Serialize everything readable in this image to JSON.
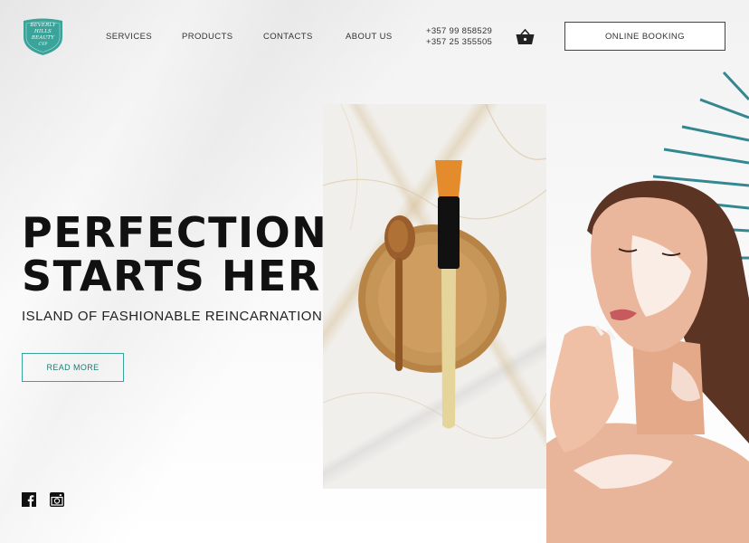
{
  "brand": {
    "logo_line1": "BEVERLY HILLS",
    "logo_line2": "BEAUTY",
    "logo_line3": "CYP",
    "accent_color": "#3aa39a"
  },
  "nav": {
    "items": [
      {
        "label": "SERVICES"
      },
      {
        "label": "PRODUCTS"
      },
      {
        "label": "CONTACTS"
      },
      {
        "label": "ABOUT US"
      }
    ]
  },
  "contact": {
    "phone1": "+357 99 858529",
    "phone2": "+357 25 355505"
  },
  "header": {
    "cart_icon": "shopping-basket-icon",
    "booking_label": "ONLINE BOOKING"
  },
  "hero": {
    "title_line1": "PERFECTION",
    "title_line2": "STARTS HERE",
    "subtitle": "ISLAND OF FASHIONABLE REINCARNATIONS",
    "cta_label": "READ MORE"
  },
  "social": {
    "icons": [
      "facebook-icon",
      "instagram-icon"
    ]
  }
}
